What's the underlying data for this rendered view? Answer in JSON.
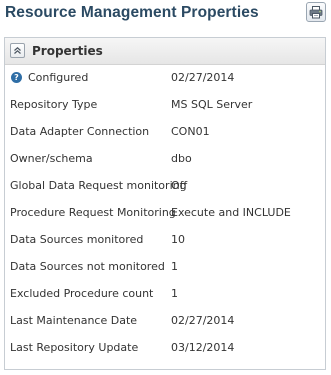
{
  "header": {
    "title": "Resource Management Properties",
    "print_icon": "printer-icon"
  },
  "panel": {
    "title": "Properties",
    "collapse_icon": "chevron-up-icon",
    "help_icon": "question-circle-icon",
    "rows": [
      {
        "label": "Configured",
        "value": "02/27/2014"
      },
      {
        "label": "Repository Type",
        "value": "MS SQL Server"
      },
      {
        "label": "Data Adapter Connection",
        "value": "CON01"
      },
      {
        "label": "Owner/schema",
        "value": "dbo"
      },
      {
        "label": "Global Data Request monitoring",
        "value": "Off"
      },
      {
        "label": "Procedure Request Monitoring",
        "value": "Execute and INCLUDE"
      },
      {
        "label": "Data Sources monitored",
        "value": "10"
      },
      {
        "label": "Data Sources not monitored",
        "value": "1"
      },
      {
        "label": "Excluded Procedure count",
        "value": "1"
      },
      {
        "label": "Last Maintenance Date",
        "value": "02/27/2014"
      },
      {
        "label": "Last Repository Update",
        "value": "03/12/2014"
      }
    ]
  },
  "colors": {
    "title": "#2b4a63",
    "help_icon": "#2f6ea6",
    "panel_border": "#c7cdd3"
  }
}
